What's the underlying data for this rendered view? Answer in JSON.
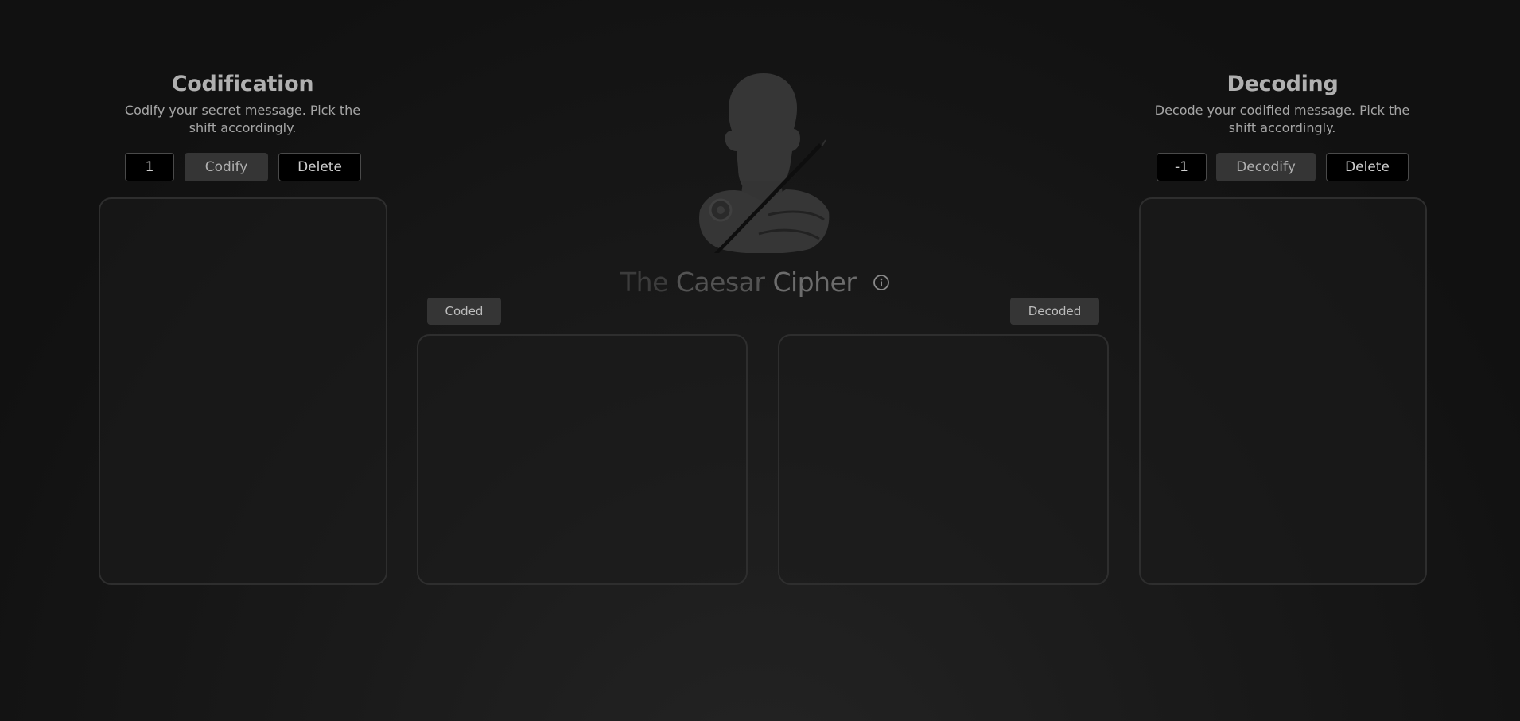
{
  "codification": {
    "title": "Codification",
    "description": "Codify your secret message. Pick the shift accordingly.",
    "shift_value": "1",
    "codify_label": "Codify",
    "delete_label": "Delete",
    "message_value": ""
  },
  "decoding": {
    "title": "Decoding",
    "description": "Decode your codified message. Pick the shift accordingly.",
    "shift_value": "-1",
    "decodify_label": "Decodify",
    "delete_label": "Delete",
    "message_value": ""
  },
  "center": {
    "logo_icon": "caesar-bust-icon",
    "title_word1": "The",
    "title_word2": "Caesar",
    "title_word3": "Cipher",
    "info_icon": "info-icon",
    "coded_label": "Coded",
    "decoded_label": "Decoded",
    "coded_output": "",
    "decoded_output": ""
  },
  "colors": {
    "background": "#111111",
    "accent_button": "#353535",
    "border": "#2e2e2e"
  }
}
